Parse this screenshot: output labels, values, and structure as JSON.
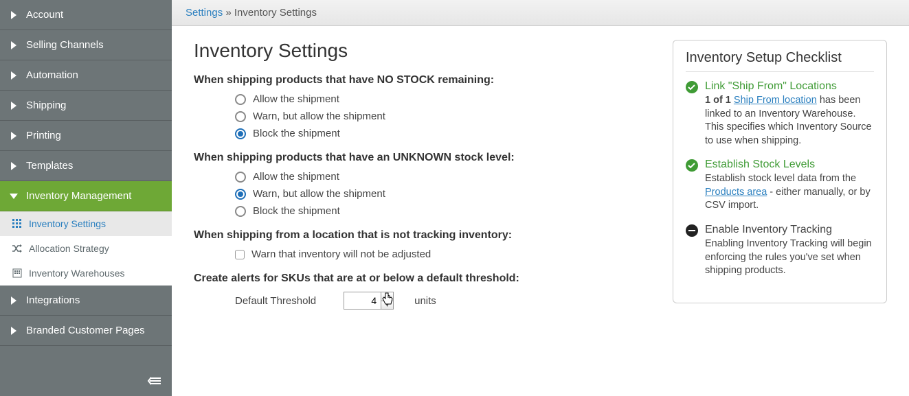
{
  "sidebar": {
    "items": [
      {
        "label": "Account"
      },
      {
        "label": "Selling Channels"
      },
      {
        "label": "Automation"
      },
      {
        "label": "Shipping"
      },
      {
        "label": "Printing"
      },
      {
        "label": "Templates"
      },
      {
        "label": "Inventory Management"
      },
      {
        "label": "Integrations"
      },
      {
        "label": "Branded Customer Pages"
      }
    ],
    "sub_items": [
      {
        "label": "Inventory Settings"
      },
      {
        "label": "Allocation Strategy"
      },
      {
        "label": "Inventory Warehouses"
      }
    ]
  },
  "breadcrumb": {
    "root": "Settings",
    "sep": "»",
    "current": "Inventory Settings"
  },
  "page_title": "Inventory Settings",
  "sections": {
    "no_stock": {
      "head": "When shipping products that have NO STOCK remaining:",
      "opts": [
        "Allow the shipment",
        "Warn, but allow the shipment",
        "Block the shipment"
      ],
      "selected": 2
    },
    "unknown_stock": {
      "head": "When shipping products that have an UNKNOWN stock level:",
      "opts": [
        "Allow the shipment",
        "Warn, but allow the shipment",
        "Block the shipment"
      ],
      "selected": 1
    },
    "not_tracking": {
      "head": "When shipping from a location that is not tracking inventory:",
      "check_label": "Warn that inventory will not be adjusted",
      "checked": false
    },
    "threshold": {
      "head": "Create alerts for SKUs that are at or below a default threshold:",
      "label": "Default Threshold",
      "value": "4",
      "units": "units"
    }
  },
  "checklist": {
    "title": "Inventory Setup Checklist",
    "items": [
      {
        "status": "done",
        "title": "Link \"Ship From\" Locations",
        "body_prefix": "1 of 1 ",
        "body_link": "Ship From location",
        "body_suffix": " has been linked to an Inventory Warehouse. This specifies which Inventory Source to use when shipping."
      },
      {
        "status": "done",
        "title": "Establish Stock Levels",
        "body_prefix": "Establish stock level data from the ",
        "body_link": "Products area",
        "body_suffix": " - either manually, or by CSV import."
      },
      {
        "status": "pending",
        "title": "Enable Inventory Tracking",
        "body_prefix": "Enabling Inventory Tracking will begin enforcing the rules you've set when shipping products.",
        "body_link": "",
        "body_suffix": ""
      }
    ]
  }
}
